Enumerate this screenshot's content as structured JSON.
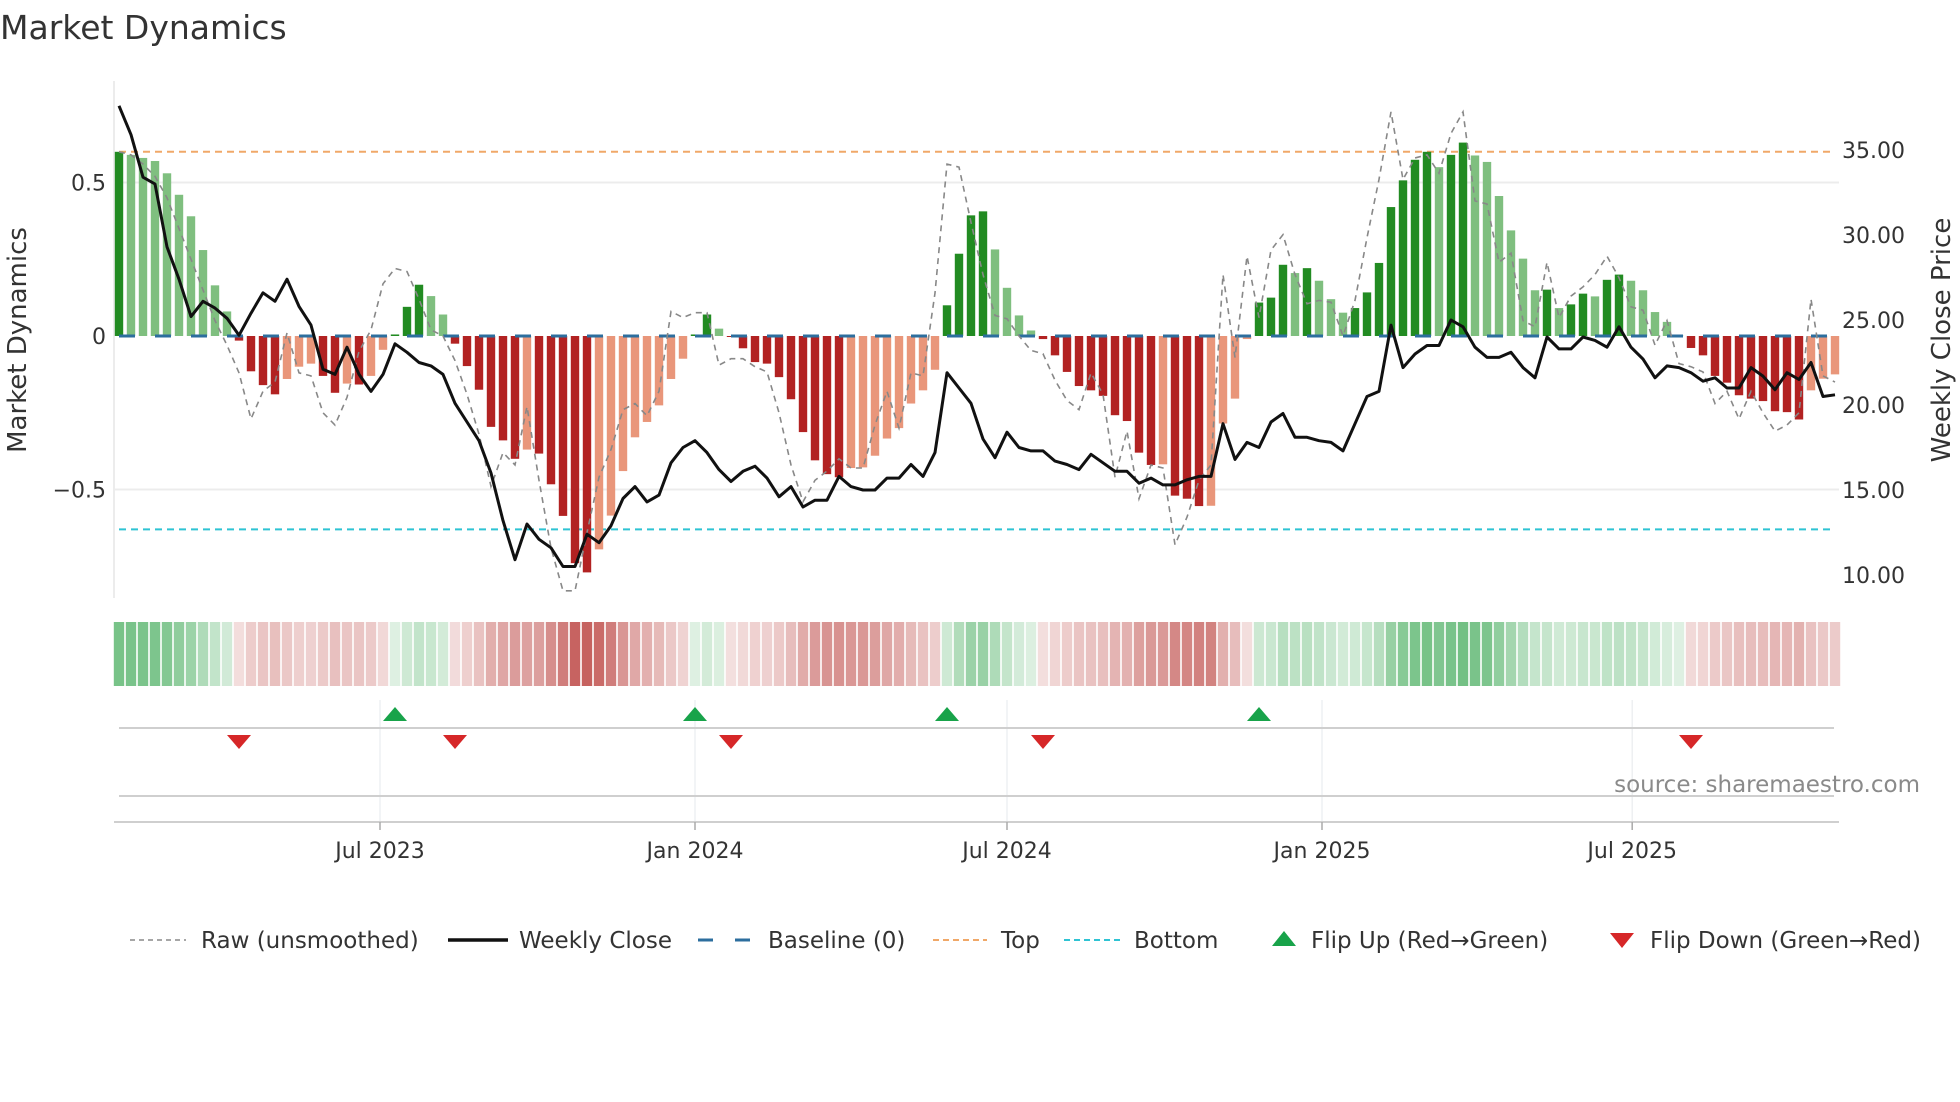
{
  "chart_data": {
    "type": "bar",
    "title": "Market Dynamics",
    "ylabel": "Market Dynamics",
    "y2label": "Weekly Close Price",
    "ylim": [
      -0.85,
      0.8
    ],
    "y2lim": [
      8.5,
      40.4
    ],
    "yticks": [
      {
        "v": 0.5,
        "label": "0.5"
      },
      {
        "v": 0,
        "label": "0"
      },
      {
        "v": -0.5,
        "label": "−0.5"
      }
    ],
    "y2ticks": [
      {
        "v": 35,
        "label": "35.00"
      },
      {
        "v": 30,
        "label": "30.00"
      },
      {
        "v": 25,
        "label": "25.00"
      },
      {
        "v": 20,
        "label": "20.00"
      },
      {
        "v": 15,
        "label": "15.00"
      },
      {
        "v": 10,
        "label": "10.00"
      }
    ],
    "x_unit": "week index",
    "xticks": [
      {
        "week": 21.75,
        "label": "Jul 2023"
      },
      {
        "week": 48,
        "label": "Jan 2024"
      },
      {
        "week": 74,
        "label": "Jul 2024"
      },
      {
        "week": 100.25,
        "label": "Jan 2025"
      },
      {
        "week": 126.1,
        "label": "Jul 2025"
      }
    ],
    "top_level": 0.6,
    "bottom_level": -0.63,
    "baseline": 0,
    "dynamics": [
      0.6,
      0.59,
      0.58,
      0.57,
      0.53,
      0.46,
      0.39,
      0.28,
      0.165,
      0.08,
      -0.015,
      -0.115,
      -0.16,
      -0.19,
      -0.14,
      -0.1,
      -0.09,
      -0.13,
      -0.185,
      -0.155,
      -0.158,
      -0.13,
      -0.045,
      0.005,
      0.095,
      0.167,
      0.13,
      0.07,
      -0.025,
      -0.098,
      -0.175,
      -0.296,
      -0.34,
      -0.4,
      -0.37,
      -0.383,
      -0.483,
      -0.586,
      -0.74,
      -0.77,
      -0.695,
      -0.585,
      -0.44,
      -0.33,
      -0.28,
      -0.226,
      -0.14,
      -0.074,
      0.005,
      0.07,
      0.024,
      -0.003,
      -0.04,
      -0.085,
      -0.09,
      -0.134,
      -0.206,
      -0.313,
      -0.405,
      -0.45,
      -0.46,
      -0.43,
      -0.428,
      -0.39,
      -0.334,
      -0.3,
      -0.22,
      -0.177,
      -0.11,
      0.1,
      0.268,
      0.393,
      0.406,
      0.282,
      0.157,
      0.067,
      0.018,
      -0.01,
      -0.063,
      -0.117,
      -0.163,
      -0.177,
      -0.195,
      -0.258,
      -0.277,
      -0.38,
      -0.42,
      -0.418,
      -0.52,
      -0.53,
      -0.554,
      -0.553,
      -0.285,
      -0.204,
      -0.01,
      0.109,
      0.125,
      0.232,
      0.205,
      0.221,
      0.18,
      0.12,
      0.076,
      0.091,
      0.142,
      0.238,
      0.42,
      0.507,
      0.574,
      0.6,
      0.55,
      0.59,
      0.63,
      0.588,
      0.567,
      0.456,
      0.344,
      0.252,
      0.149,
      0.151,
      0.091,
      0.103,
      0.138,
      0.129,
      0.183,
      0.2,
      0.18,
      0.149,
      0.078,
      0.046,
      0.003,
      -0.039,
      -0.063,
      -0.13,
      -0.152,
      -0.193,
      -0.204,
      -0.212,
      -0.245,
      -0.248,
      -0.272,
      -0.177,
      -0.139,
      -0.125
    ],
    "raw": [
      0.6,
      0.59,
      0.56,
      0.52,
      0.45,
      0.35,
      0.25,
      0.15,
      0.05,
      -0.03,
      -0.12,
      -0.27,
      -0.18,
      -0.15,
      0.01,
      -0.12,
      -0.13,
      -0.25,
      -0.29,
      -0.2,
      -0.05,
      0.02,
      0.17,
      0.22,
      0.21,
      0.12,
      0.02,
      0.0,
      -0.08,
      -0.19,
      -0.32,
      -0.49,
      -0.38,
      -0.42,
      -0.23,
      -0.47,
      -0.69,
      -0.83,
      -0.83,
      -0.64,
      -0.46,
      -0.37,
      -0.24,
      -0.22,
      -0.26,
      -0.18,
      0.08,
      0.06,
      0.076,
      0.076,
      -0.095,
      -0.074,
      -0.074,
      -0.1,
      -0.117,
      -0.25,
      -0.42,
      -0.54,
      -0.47,
      -0.44,
      -0.4,
      -0.43,
      -0.43,
      -0.29,
      -0.18,
      -0.3,
      -0.12,
      -0.13,
      0.14,
      0.56,
      0.55,
      0.37,
      0.2,
      0.067,
      0.056,
      0.0,
      -0.047,
      -0.058,
      -0.144,
      -0.21,
      -0.24,
      -0.12,
      -0.19,
      -0.46,
      -0.31,
      -0.53,
      -0.42,
      -0.43,
      -0.68,
      -0.59,
      -0.47,
      -0.42,
      0.2,
      -0.07,
      0.26,
      0.06,
      0.28,
      0.33,
      0.2,
      0.105,
      0.116,
      0.11,
      0.0,
      0.116,
      0.32,
      0.51,
      0.73,
      0.51,
      0.58,
      0.59,
      0.53,
      0.66,
      0.73,
      0.44,
      0.43,
      0.24,
      0.27,
      0.05,
      0.03,
      0.24,
      0.06,
      0.13,
      0.16,
      0.2,
      0.26,
      0.19,
      0.095,
      0.084,
      -0.03,
      0.05,
      -0.09,
      -0.1,
      -0.117,
      -0.22,
      -0.18,
      -0.27,
      -0.18,
      -0.25,
      -0.31,
      -0.29,
      -0.25,
      0.12,
      -0.13,
      -0.15
    ],
    "weekly_close": [
      37.6,
      35.9,
      33.4,
      33.0,
      29.3,
      27.4,
      25.2,
      26.1,
      25.7,
      25.1,
      24.1,
      25.4,
      26.6,
      26.1,
      27.4,
      25.8,
      24.7,
      22.1,
      21.8,
      23.4,
      21.8,
      20.8,
      21.8,
      23.6,
      23.1,
      22.5,
      22.3,
      21.8,
      20.1,
      19.0,
      17.9,
      16.0,
      13.2,
      10.9,
      13.0,
      12.1,
      11.6,
      10.5,
      10.5,
      12.4,
      11.9,
      12.9,
      14.5,
      15.2,
      14.3,
      14.7,
      16.6,
      17.5,
      17.9,
      17.2,
      16.2,
      15.5,
      16.1,
      16.4,
      15.7,
      14.6,
      15.2,
      14.0,
      14.4,
      14.4,
      15.8,
      15.2,
      15.0,
      15.0,
      15.7,
      15.7,
      16.5,
      15.8,
      17.2,
      21.9,
      21.0,
      20.1,
      18.0,
      16.9,
      18.4,
      17.5,
      17.3,
      17.3,
      16.7,
      16.5,
      16.2,
      17.1,
      16.6,
      16.1,
      16.1,
      15.4,
      15.7,
      15.3,
      15.3,
      15.6,
      15.8,
      15.8,
      18.9,
      16.8,
      17.8,
      17.5,
      19.0,
      19.5,
      18.1,
      18.1,
      17.9,
      17.8,
      17.3,
      18.9,
      20.5,
      20.8,
      24.7,
      22.2,
      23.0,
      23.5,
      23.5,
      25.0,
      24.6,
      23.4,
      22.8,
      22.8,
      23.1,
      22.2,
      21.6,
      24.0,
      23.3,
      23.3,
      24.0,
      23.8,
      23.4,
      24.6,
      23.4,
      22.7,
      21.6,
      22.3,
      22.2,
      21.9,
      21.4,
      21.6,
      21.0,
      21.0,
      22.2,
      21.7,
      20.9,
      21.9,
      21.5,
      22.5,
      20.5,
      20.6
    ],
    "flip_up_weeks": [
      23,
      48,
      69,
      95
    ],
    "flip_down_weeks": [
      10,
      28,
      51,
      77,
      131
    ],
    "legend": {
      "placement": "bottom",
      "items": [
        {
          "key": "raw",
          "label": "Raw (unsmoothed)"
        },
        {
          "key": "close",
          "label": "Weekly Close"
        },
        {
          "key": "baseline",
          "label": "Baseline (0)"
        },
        {
          "key": "top",
          "label": "Top"
        },
        {
          "key": "bottom",
          "label": "Bottom"
        },
        {
          "key": "flip_up",
          "label": "Flip Up (Red→Green)"
        },
        {
          "key": "flip_down",
          "label": "Flip Down (Green→Red)"
        }
      ]
    },
    "source": "source: sharemaestro.com",
    "colors": {
      "up_strong": "#228b22",
      "up_weak": "#7fbf7f",
      "down_strong": "#b22222",
      "down_weak": "#e9967a",
      "close": "#111111",
      "raw": "#888888",
      "baseline": "#2c6e9e",
      "top": "#f0a868",
      "bottom": "#2fc3d3",
      "flip_up": "#18a34a",
      "flip_down": "#d62728",
      "heat_up": "#4caf62",
      "heat_down": "#c0504d"
    }
  }
}
